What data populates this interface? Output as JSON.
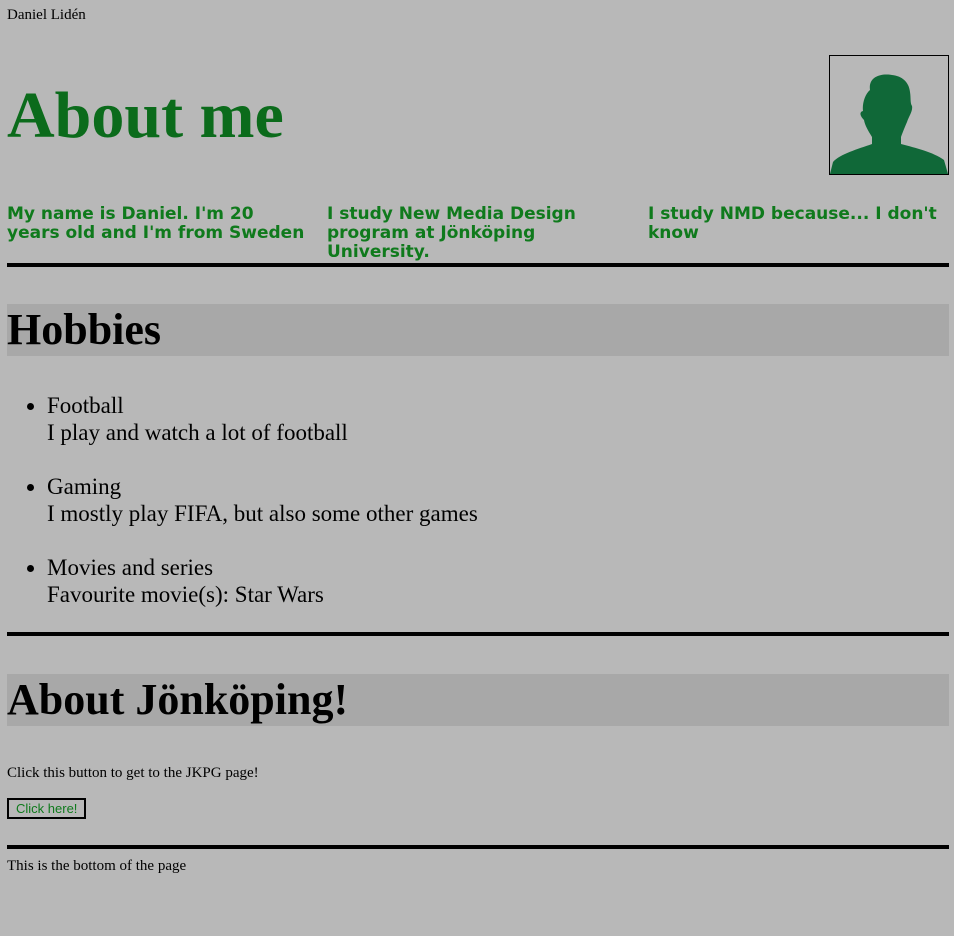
{
  "header": {
    "author": "Daniel Lidén",
    "title": "About me",
    "avatar_icon": "person-silhouette-icon"
  },
  "intro": [
    "My name is Daniel. I'm 20 years old and I'm from Sweden",
    "I study New Media Design program at Jönköping University.",
    "I study NMD because... I don't know"
  ],
  "hobbies": {
    "heading": "Hobbies",
    "items": [
      {
        "name": "Football",
        "detail": "I play and watch a lot of football"
      },
      {
        "name": "Gaming",
        "detail": "I mostly play FIFA, but also some other games"
      },
      {
        "name": "Movies and series",
        "detail": "Favourite movie(s): Star Wars"
      }
    ]
  },
  "jonkoping": {
    "heading": "About Jönköping!",
    "text": "Click this button to get to the JKPG page!",
    "button_label": "Click here!"
  },
  "footer": {
    "text": "This is the bottom of the page"
  },
  "colors": {
    "background": "#b8b8b8",
    "heading_band": "#a8a8a8",
    "accent_green": "#0b6b1b",
    "avatar_green": "#106838"
  }
}
